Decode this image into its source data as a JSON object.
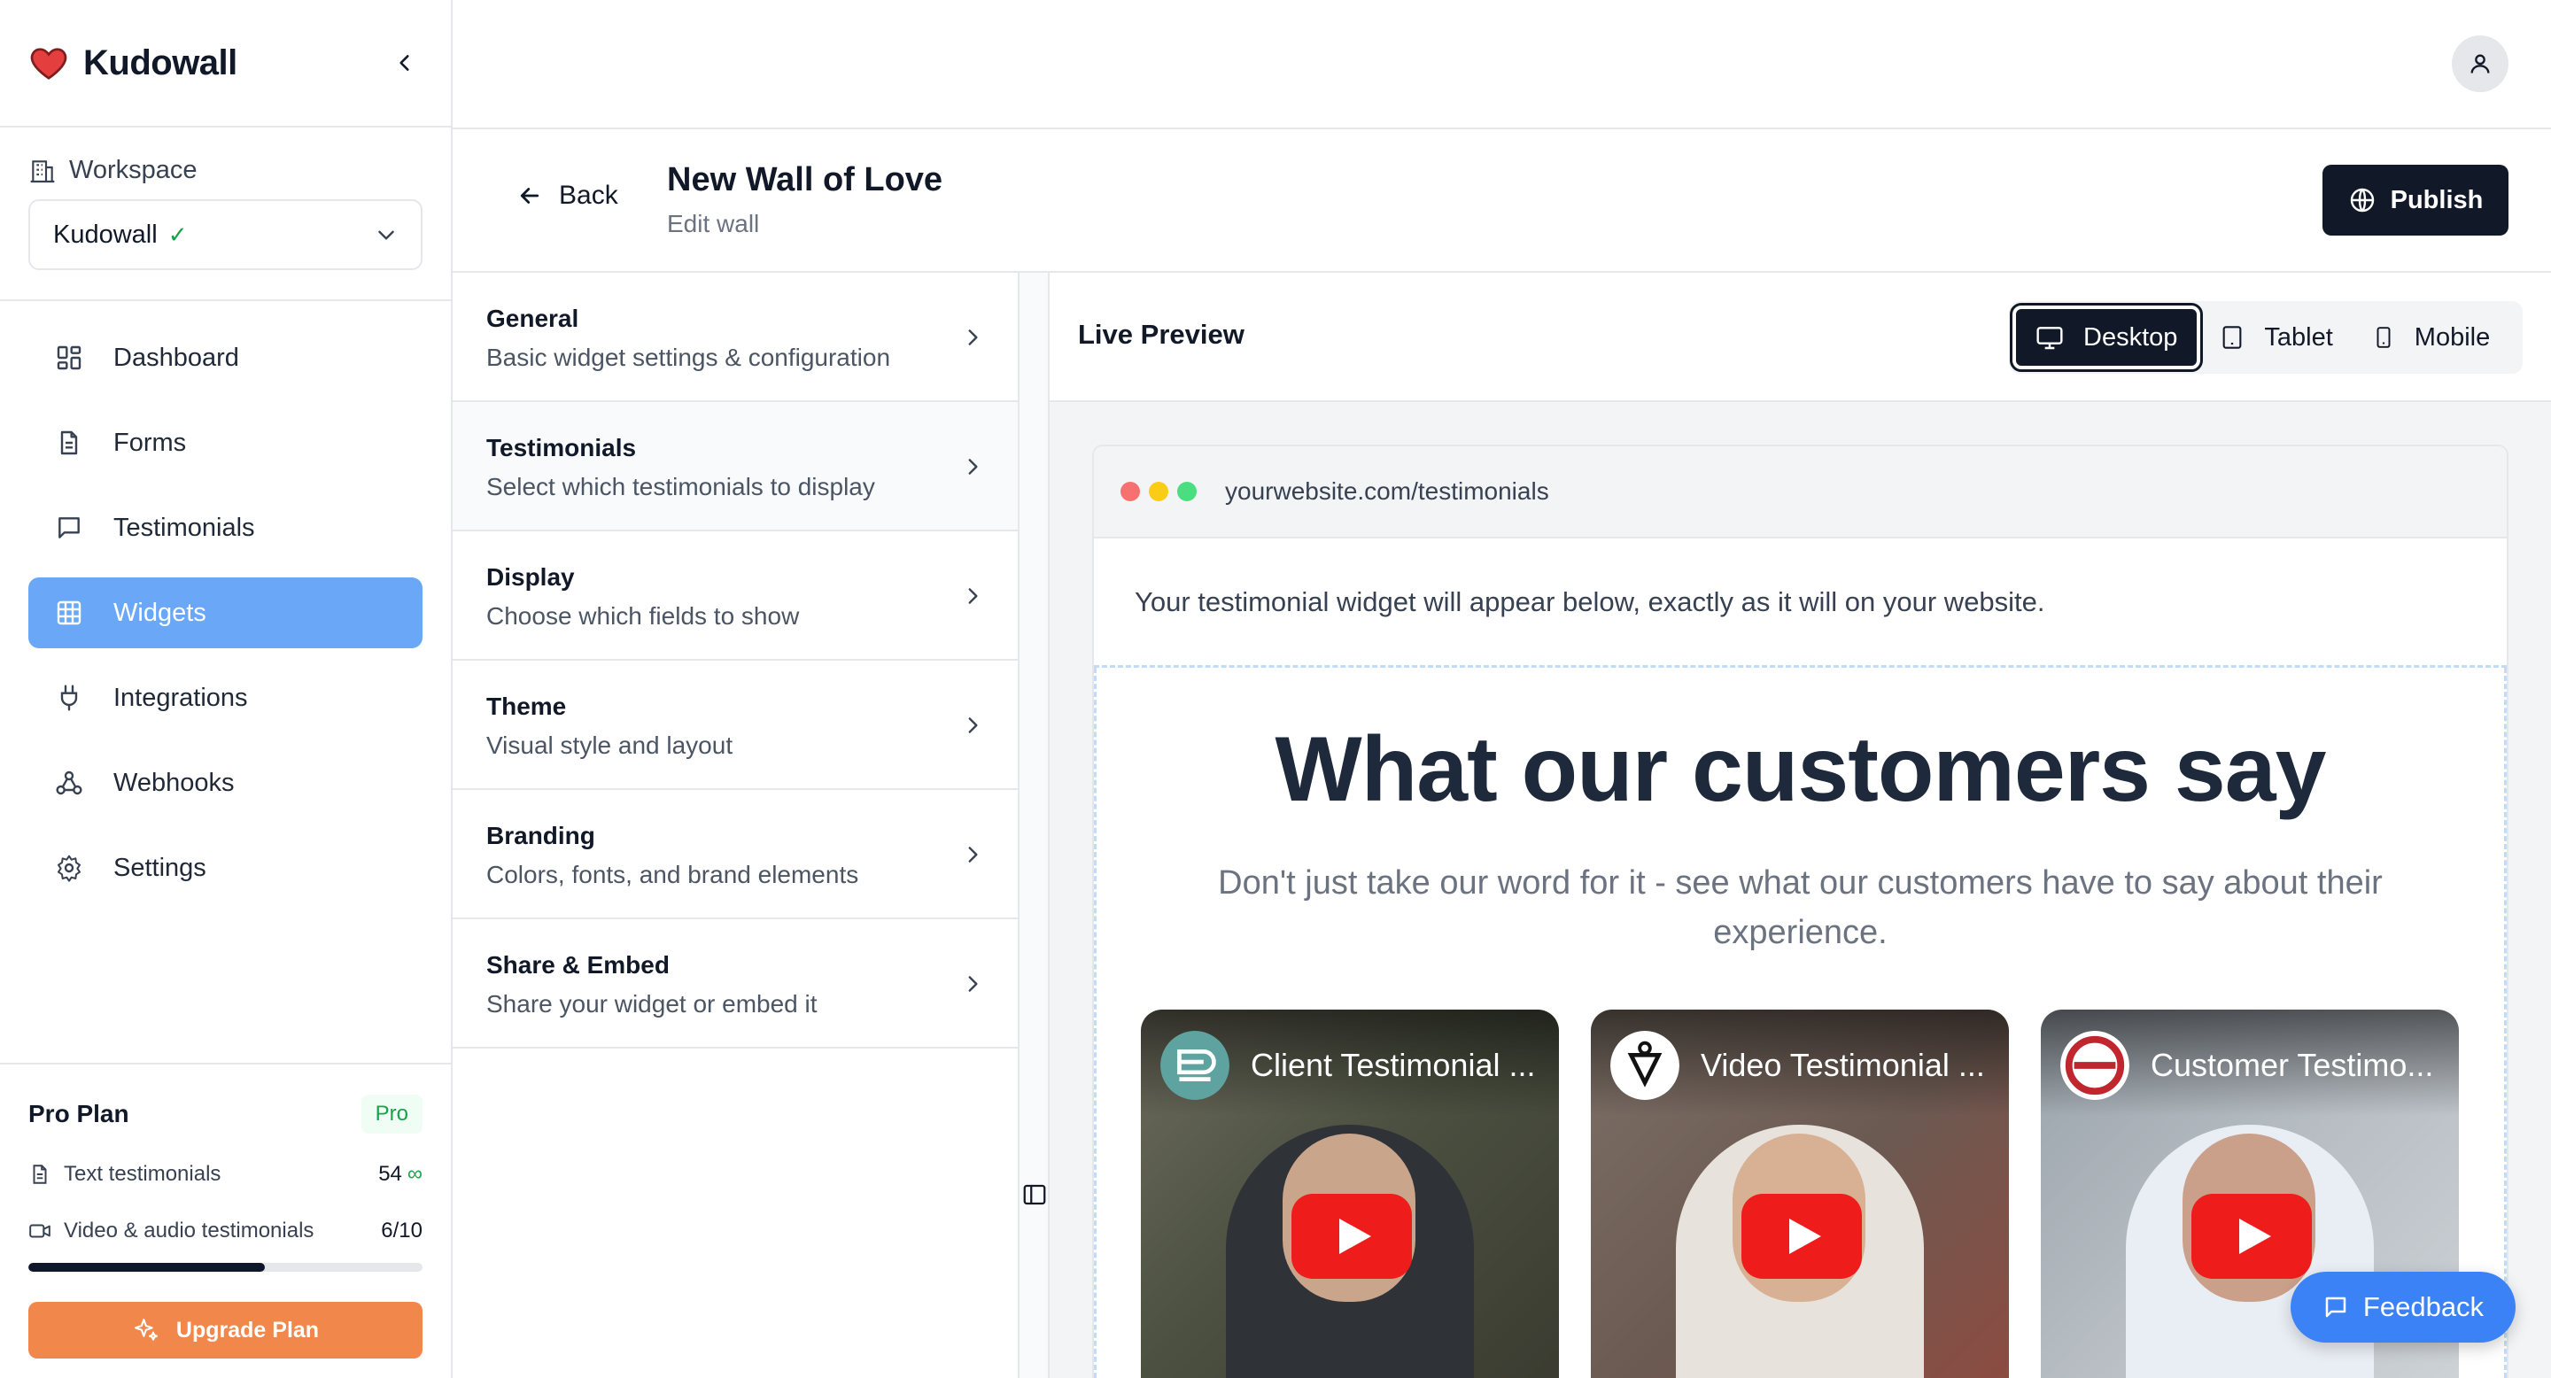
{
  "app": {
    "name": "Kudowall",
    "brand_color": "#e53e3e"
  },
  "workspace": {
    "label": "Workspace",
    "selected": "Kudowall",
    "verified_mark": "✓"
  },
  "nav": {
    "items": [
      {
        "label": "Dashboard",
        "icon": "dashboard-icon"
      },
      {
        "label": "Forms",
        "icon": "file-icon"
      },
      {
        "label": "Testimonials",
        "icon": "message-icon"
      },
      {
        "label": "Widgets",
        "icon": "grid-icon",
        "active": true
      },
      {
        "label": "Integrations",
        "icon": "plug-icon"
      },
      {
        "label": "Webhooks",
        "icon": "webhook-icon"
      },
      {
        "label": "Settings",
        "icon": "gear-icon"
      }
    ],
    "active_color": "#6aa8f7"
  },
  "plan": {
    "title": "Pro Plan",
    "badge": "Pro",
    "text_label": "Text testimonials",
    "text_value": "54",
    "text_limit": "∞",
    "video_label": "Video & audio testimonials",
    "video_value": "6/10",
    "video_usage_fraction": 0.6,
    "upgrade_label": "Upgrade Plan",
    "upgrade_color": "#f2874b"
  },
  "header": {
    "back_label": "Back",
    "title": "New Wall of Love",
    "subtitle": "Edit wall",
    "publish_label": "Publish"
  },
  "settings": [
    {
      "title": "General",
      "desc": "Basic widget settings & configuration"
    },
    {
      "title": "Testimonials",
      "desc": "Select which testimonials to display"
    },
    {
      "title": "Display",
      "desc": "Choose which fields to show"
    },
    {
      "title": "Theme",
      "desc": "Visual style and layout"
    },
    {
      "title": "Branding",
      "desc": "Colors, fonts, and brand elements"
    },
    {
      "title": "Share & Embed",
      "desc": "Share your widget or embed it"
    }
  ],
  "preview": {
    "title": "Live Preview",
    "devices": {
      "desktop": "Desktop",
      "tablet": "Tablet",
      "mobile": "Mobile",
      "selected": "Desktop"
    },
    "url": "yourwebsite.com/testimonials",
    "notice": "Your testimonial widget will appear below, exactly as it will on your website.",
    "widget_title": "What our customers say",
    "widget_subtitle": "Don't just take our word for it - see what our customers have to say about their experience.",
    "videos": [
      {
        "title": "Client Testimonial ...",
        "channel_icon": "nga-logo-icon"
      },
      {
        "title": "Video Testimonial ...",
        "channel_icon": "shield-logo-icon"
      },
      {
        "title": "Customer Testimo...",
        "channel_icon": "circle-logo-icon"
      }
    ]
  },
  "feedback_label": "Feedback"
}
